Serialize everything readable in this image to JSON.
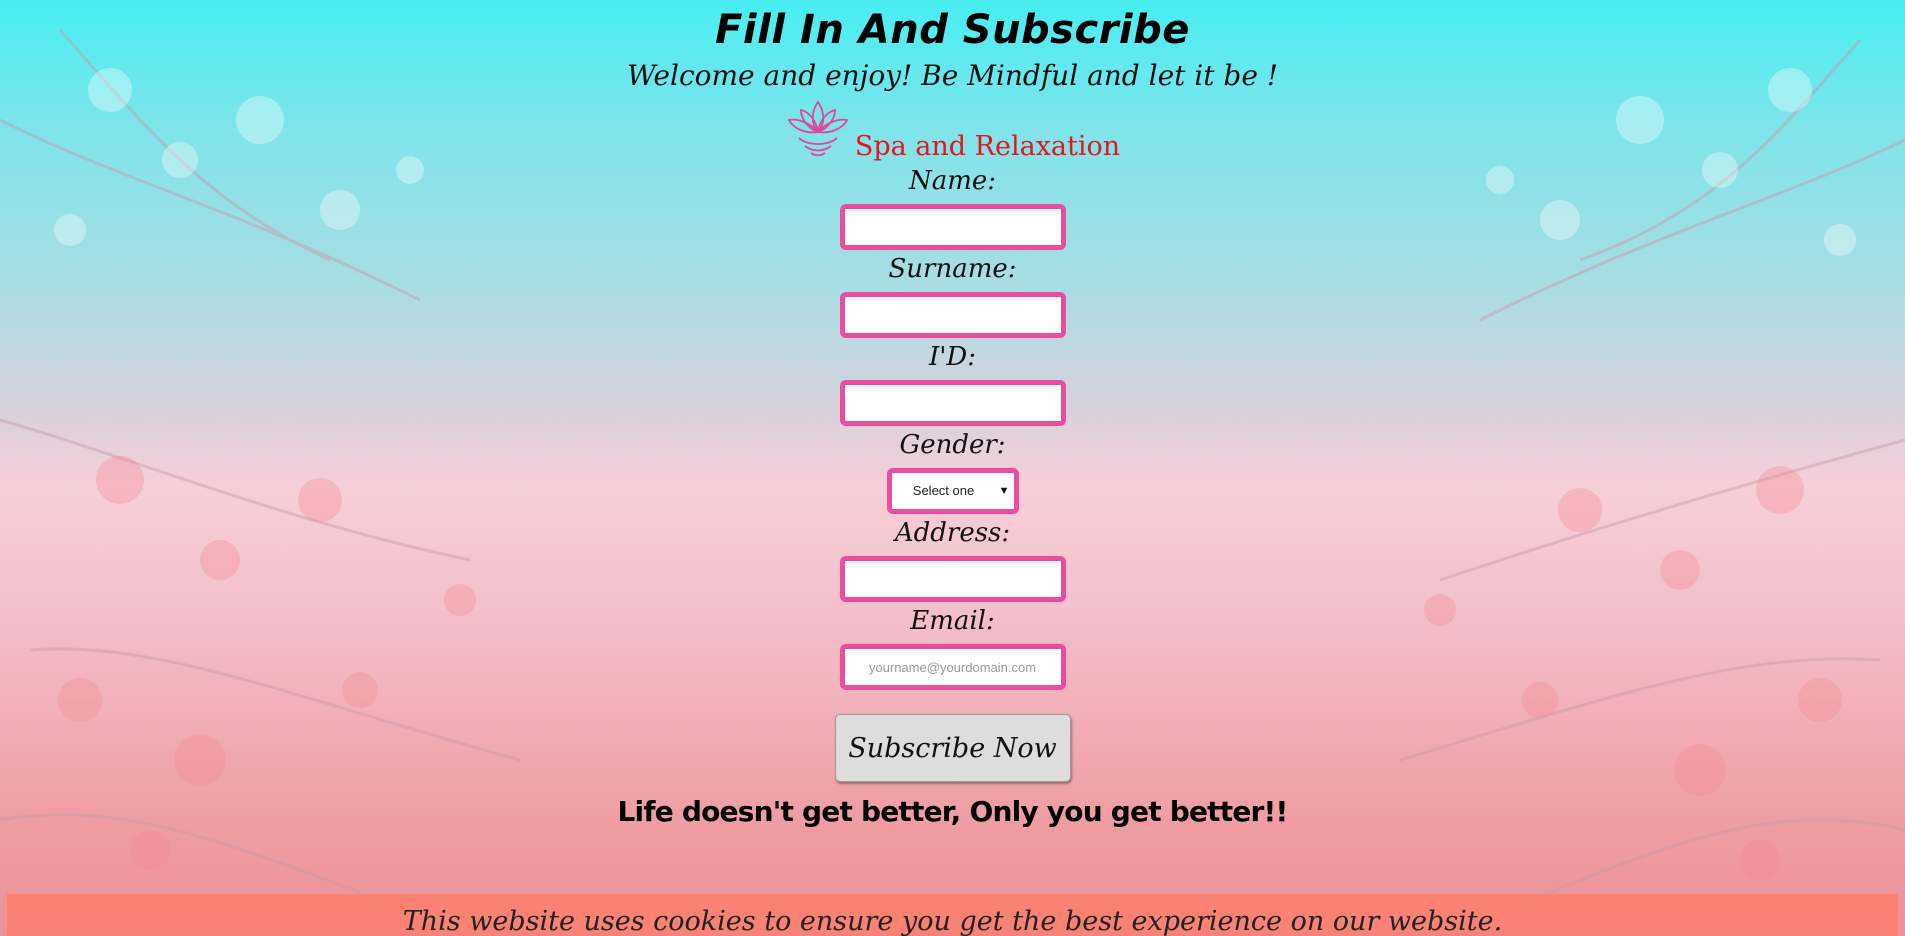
{
  "page": {
    "title": "Fill In And Subscribe",
    "subtitle": "Welcome and enjoy! Be Mindful and let it be !"
  },
  "brand": {
    "name": "Spa and Relaxation",
    "logo_icon": "lotus-icon",
    "color": "#e6141b"
  },
  "form": {
    "name_label": "Name:",
    "name_value": "",
    "surname_label": "Surname:",
    "surname_value": "",
    "id_label": "I'D:",
    "id_value": "",
    "gender_label": "Gender:",
    "gender_selected": "Select one",
    "address_label": "Address:",
    "address_value": "",
    "email_label": "Email:",
    "email_placeholder": "yourname@yourdomain.com",
    "email_value": "",
    "submit_label": "Subscribe Now",
    "border_color": "#ea4c9e"
  },
  "tagline": "Life doesn't get better, Only you get better!!",
  "cookie_bar": {
    "text": "This website uses cookies to ensure you get the best experience on our website.",
    "color": "#fa8072"
  },
  "background": {
    "top_color": "#47eef2",
    "bottom_color": "#ec9197"
  }
}
